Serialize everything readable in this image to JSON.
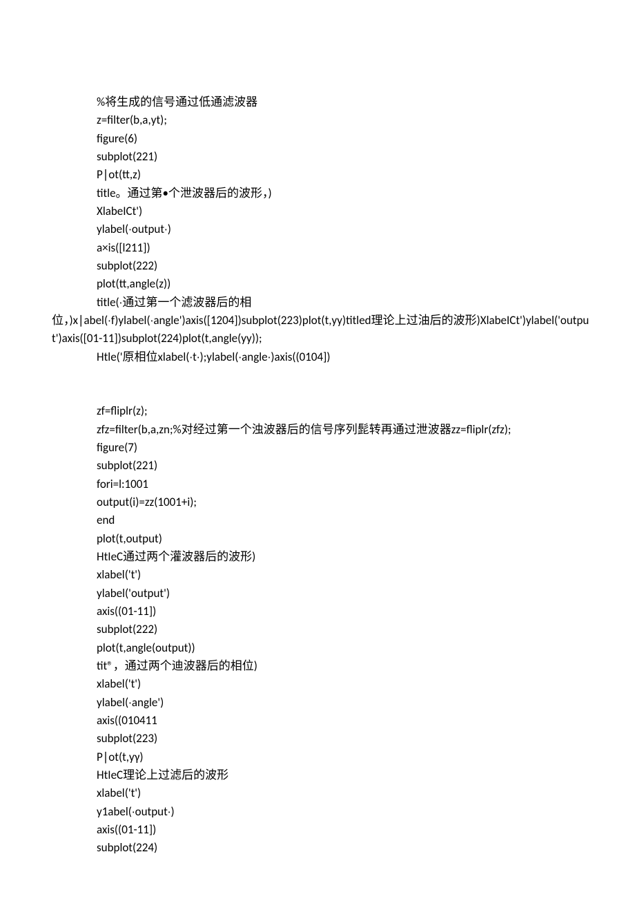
{
  "lines": [
    "%将生成的信号通过低通滤波器",
    "z=filter(b,a,yt);",
    "figure(6)",
    "subplot(221)",
    "P∣ot(tt,z)",
    "title。通过第•个泄波器后的波形，)",
    "XlabeICt')",
    "ylabel(∙output∙)",
    "a×is([l211])",
    "subplot(222)",
    "plot(tt,angle(z))",
    "title(∙通过第一个滤波器后的相"
  ],
  "wrap1": "位，)x∣abel(∙f)ylabel(∙angle')axis([1204])subplot(223)plot(t,yy)titled理论上过油后的波形)XlabeICt')ylabel('output')axis([01-11])subplot(224)plot(t,angle(yy));",
  "line_after_wrap": "Htle('原相位xlabel(∙t∙);ylabel(∙angle∙)axis((0104])",
  "lines2": [
    "zf=fliplr(z);",
    "zfz=filter(b,a,zn;%对经过第一个浊波器后的信号序列髭转再通过泄波器zz=fliplr(zfz);",
    "figure(7)",
    "subplot(221)",
    "fori=l:1001",
    "output(i)=zz(1001+i);",
    "end",
    "plot(t,output)",
    "HtIeC通过两个灌波器后的波形)",
    "xlabel('t')",
    "ylabel('output')",
    "axis((01-11])",
    "subplot(222)",
    "plot(t,angle(output))",
    "tit®，通过两个迪波器后的相位)",
    "xlabel('t')",
    "ylabel(∙angle')",
    "axis((010411",
    "subplot(223)",
    "P∣ot(t,yγ)",
    "HtIeC理论上过滤后的波形",
    "xlabel('t')",
    "y1abel(∙output∙)",
    "axis((01-11])",
    "subplot(224)"
  ]
}
